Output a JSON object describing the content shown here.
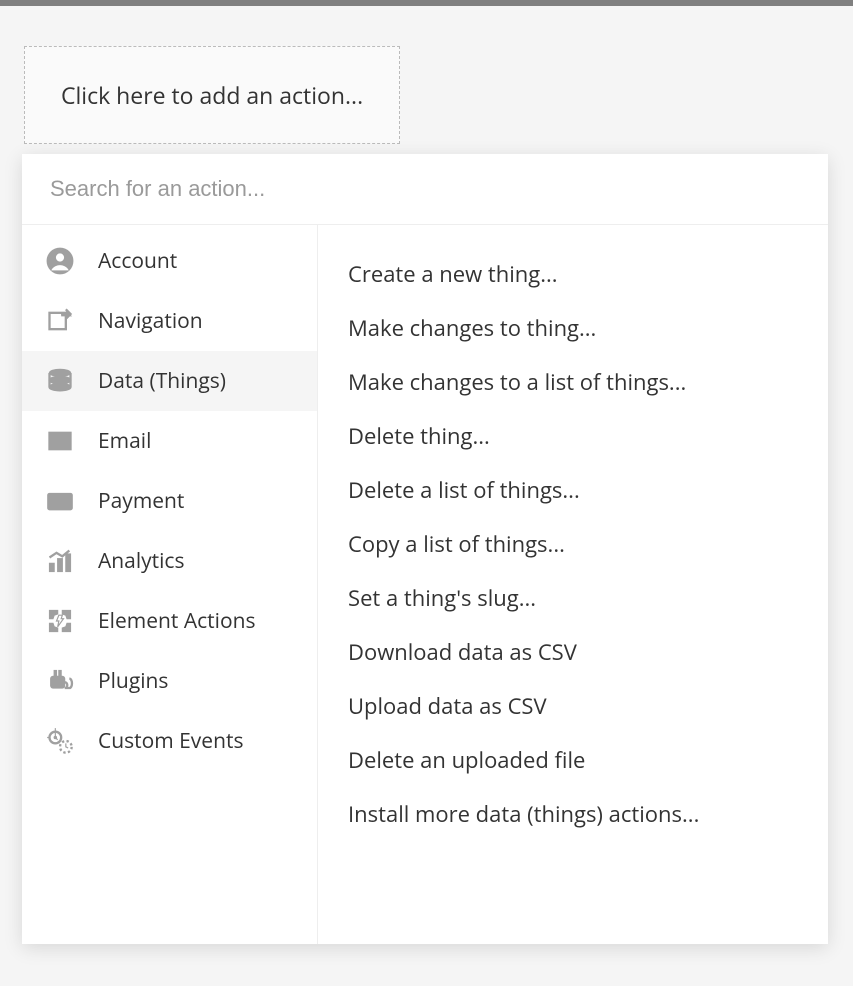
{
  "add_action": {
    "label": "Click here to add an action..."
  },
  "search": {
    "placeholder": "Search for an action..."
  },
  "categories": [
    {
      "label": "Account",
      "icon": "account-icon"
    },
    {
      "label": "Navigation",
      "icon": "navigation-icon"
    },
    {
      "label": "Data (Things)",
      "icon": "database-icon"
    },
    {
      "label": "Email",
      "icon": "email-icon"
    },
    {
      "label": "Payment",
      "icon": "payment-icon"
    },
    {
      "label": "Analytics",
      "icon": "analytics-icon"
    },
    {
      "label": "Element Actions",
      "icon": "element-actions-icon"
    },
    {
      "label": "Plugins",
      "icon": "plugins-icon"
    },
    {
      "label": "Custom Events",
      "icon": "custom-events-icon"
    }
  ],
  "selected_category_index": 2,
  "actions": [
    "Create a new thing...",
    "Make changes to thing...",
    "Make changes to a list of things...",
    "Delete thing...",
    "Delete a list of things...",
    "Copy a list of things...",
    "Set a thing's slug...",
    "Download data as CSV",
    "Upload data as CSV",
    "Delete an uploaded file",
    "Install more data (things) actions..."
  ]
}
